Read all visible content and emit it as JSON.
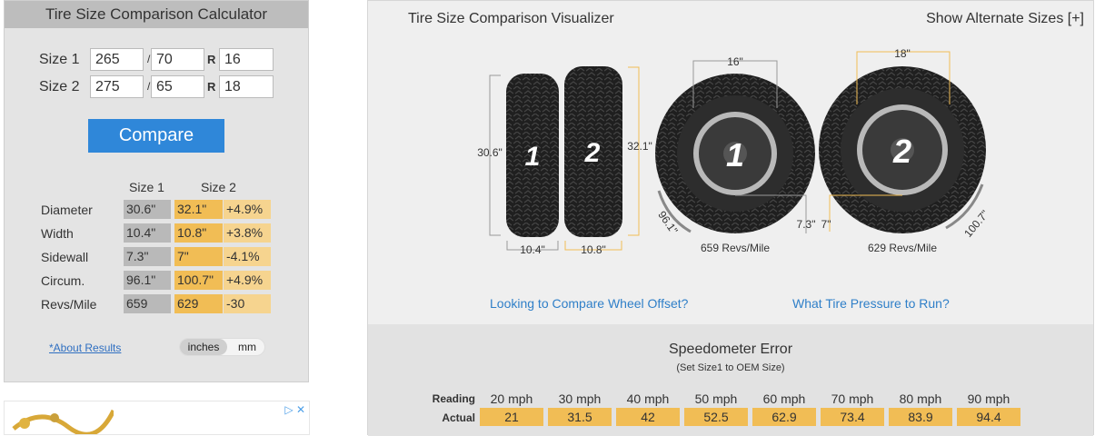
{
  "calculator": {
    "title": "Tire Size Comparison Calculator",
    "size1": {
      "label": "Size 1",
      "width": "265",
      "aspect": "70",
      "rim": "16"
    },
    "size2": {
      "label": "Size 2",
      "width": "275",
      "aspect": "65",
      "rim": "18"
    },
    "slash": "/",
    "r_letter": "R",
    "compare_label": "Compare",
    "results": {
      "head_size1": "Size 1",
      "head_size2": "Size 2",
      "rows": [
        {
          "name": "Diameter",
          "s1": "30.6\"",
          "s2": "32.1\"",
          "diff": "+4.9%"
        },
        {
          "name": "Width",
          "s1": "10.4\"",
          "s2": "10.8\"",
          "diff": "+3.8%"
        },
        {
          "name": "Sidewall",
          "s1": "7.3\"",
          "s2": "7\"",
          "diff": "-4.1%"
        },
        {
          "name": "Circum.",
          "s1": "96.1\"",
          "s2": "100.7\"",
          "diff": "+4.9%"
        },
        {
          "name": "Revs/Mile",
          "s1": "659",
          "s2": "629",
          "diff": "-30"
        }
      ]
    },
    "about_link": "*About Results",
    "unit_inches": "inches",
    "unit_mm": "mm"
  },
  "ad": {
    "icons": "▷ ✕"
  },
  "visualizer": {
    "title": "Tire Size Comparison Visualizer",
    "alt_sizes": "Show Alternate Sizes [+]",
    "tire1": {
      "number": "1",
      "diameter": "30.6\"",
      "width": "10.4\"",
      "rim": "16\"",
      "sidewall": "7.3\"",
      "circum": "96.1\"",
      "revs": "659 Revs/Mile"
    },
    "tire2": {
      "number": "2",
      "diameter": "32.1\"",
      "width": "10.8\"",
      "rim": "18\"",
      "sidewall": "7\"",
      "circum": "100.7\"",
      "revs": "629 Revs/Mile"
    },
    "link_offset": "Looking to Compare Wheel Offset?",
    "link_pressure": "What Tire Pressure to Run?",
    "colors": {
      "accent": "#f1bd55",
      "button": "#2f87d9",
      "link": "#2f7fc8"
    }
  },
  "speedometer": {
    "title": "Speedometer Error",
    "subtitle": "(Set Size1 to OEM Size)",
    "reading_label": "Reading",
    "actual_label": "Actual",
    "readings": [
      "20 mph",
      "30 mph",
      "40 mph",
      "50 mph",
      "60 mph",
      "70 mph",
      "80 mph",
      "90 mph"
    ],
    "actuals": [
      "21",
      "31.5",
      "42",
      "52.5",
      "62.9",
      "73.4",
      "83.9",
      "94.4"
    ]
  }
}
